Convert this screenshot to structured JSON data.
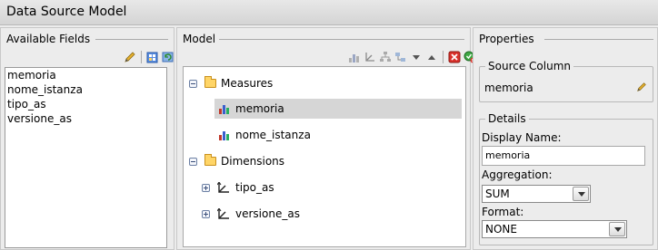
{
  "window": {
    "title": "Data Source Model"
  },
  "available_fields": {
    "heading": "Available Fields",
    "toolbar_icons": [
      "pencil-icon",
      "add-field-icon",
      "refresh-icon"
    ],
    "items": [
      "memoria",
      "nome_istanza",
      "tipo_as",
      "versione_as"
    ]
  },
  "model": {
    "heading": "Model",
    "toolbar_icons": [
      "add-measure-icon",
      "add-dimension-icon",
      "hierarchy-icon",
      "level-icon",
      "move-down-icon",
      "move-up-icon",
      "delete-icon",
      "validate-icon"
    ],
    "tree": {
      "measures": {
        "label": "Measures",
        "items": [
          "memoria",
          "nome_istanza"
        ],
        "selected": "memoria"
      },
      "dimensions": {
        "label": "Dimensions",
        "items": [
          "tipo_as",
          "versione_as"
        ]
      }
    }
  },
  "properties": {
    "heading": "Properties",
    "source_column": {
      "heading": "Source Column",
      "value": "memoria"
    },
    "details": {
      "heading": "Details",
      "display_name_label": "Display Name:",
      "display_name_value": "memoria",
      "aggregation_label": "Aggregation:",
      "aggregation_value": "SUM",
      "format_label": "Format:",
      "format_value": "NONE"
    }
  },
  "colors": {
    "selection": "#d6d6d6",
    "folder": "#ffd567",
    "bar_blue": "#3a5fcd",
    "bar_red": "#c0392b",
    "bar_green": "#27ae60"
  }
}
